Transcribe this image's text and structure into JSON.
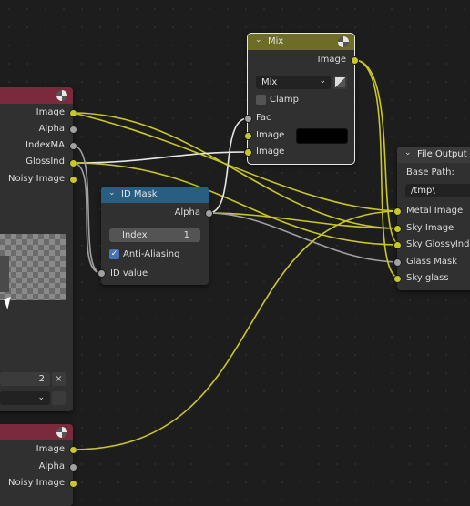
{
  "mix_node": {
    "title": "Mix",
    "output_image": "Image",
    "blend_mode": "Mix",
    "clamp_label": "Clamp",
    "fac_label": "Fac",
    "image1_label": "Image",
    "image2_label": "Image",
    "color_value": "#000000"
  },
  "left_node_top": {
    "outputs": [
      "Image",
      "Alpha",
      "IndexMA",
      "GlossInd",
      "Noisy Image"
    ],
    "frame_value": "2",
    "header_color": "#7a2a3c"
  },
  "id_mask_node": {
    "title": "ID Mask",
    "output_alpha": "Alpha",
    "index_label": "Index",
    "index_value": "1",
    "anti_aliasing_label": "Anti-Aliasing",
    "anti_aliasing_checked": true,
    "id_value_label": "ID value",
    "header_color": "#275e82"
  },
  "file_output_node": {
    "title": "File Output",
    "base_path_label": "Base Path:",
    "base_path_value": "/tmp\\",
    "inputs": [
      "Metal Image",
      "Sky Image",
      "Sky GlossyInd",
      "Glass Mask",
      "Sky glass"
    ]
  },
  "left_node_bottom": {
    "outputs": [
      "Image",
      "Alpha",
      "Noisy Image"
    ]
  },
  "colors": {
    "image_socket": "#c7c729",
    "value_socket": "#a1a1a1",
    "mix_header": "#6d6d26",
    "render_layer_header": "#7a2a3c",
    "id_mask_header": "#275e82"
  }
}
